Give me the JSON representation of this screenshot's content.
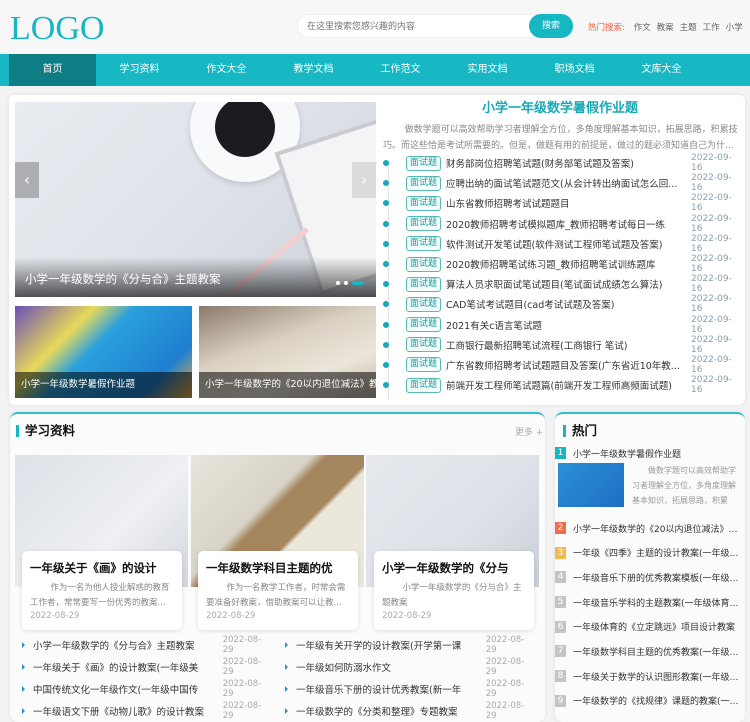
{
  "header": {
    "logo": "LOGO",
    "search_placeholder": "在这里搜索您感兴趣的内容",
    "search_button": "搜索",
    "hot_label": "热门搜索:",
    "hot_terms": [
      "作文",
      "教案",
      "主题",
      "工作",
      "小学"
    ]
  },
  "nav": {
    "items": [
      "首页",
      "学习资料",
      "作文大全",
      "教学文档",
      "工作范文",
      "实用文档",
      "职场文档",
      "文库大全"
    ],
    "active": 0
  },
  "slider": {
    "caption": "小学一年级数学的《分与合》主题教案",
    "prev": "‹",
    "next": "›",
    "slide_count": 3,
    "active_slide": 3
  },
  "thumbs": [
    {
      "caption": "小学一年级数学暑假作业题"
    },
    {
      "caption": "小学一年级数学的《20以内退位减法》教案"
    }
  ],
  "featured": {
    "title": "小学一年级数学暑假作业题",
    "desc": "做数学题可以高效帮助学习者理解全方位，多角度理解基本知识，拓展思路，积累技巧。而这些恰是考试所需要的。但是，做题有用的前提是，做过的题必须知道自己为什...",
    "tag": "面试题",
    "items": [
      {
        "title": "财务部岗位招聘笔试题(财务部笔试题及答案)",
        "date": "2022-09-16"
      },
      {
        "title": "应聘出纳的面试笔试题范文(从会计转出纳面试怎么回...",
        "date": "2022-09-16"
      },
      {
        "title": "山东省教师招聘考试试题题目",
        "date": "2022-09-16"
      },
      {
        "title": "2020教师招聘考试模拟题库_教师招聘考试每日一练",
        "date": "2022-09-16"
      },
      {
        "title": "软件测试开发笔试题(软件测试工程师笔试题及答案)",
        "date": "2022-09-16"
      },
      {
        "title": "2020教师招聘笔试练习题_教师招聘笔试训练题库",
        "date": "2022-09-16"
      },
      {
        "title": "算法人员求职面试笔试题目(笔试面试成绩怎么算法)",
        "date": "2022-09-16"
      },
      {
        "title": "CAD笔试考试题目(cad考试试题及答案)",
        "date": "2022-09-16"
      },
      {
        "title": "2021有关c语言笔试题",
        "date": "2022-09-16"
      },
      {
        "title": "工商银行最新招聘笔试流程(工商银行 笔试)",
        "date": "2022-09-16"
      },
      {
        "title": "广东省教师招聘考试试题题目及答案(广东省近10年教...",
        "date": "2022-09-16"
      },
      {
        "title": "前端开发工程师笔试题篇(前端开发工程师高频面试题)",
        "date": "2022-09-16"
      }
    ]
  },
  "study": {
    "title": "学习资料",
    "more": "更多 +",
    "cards": [
      {
        "title": "一年级关于《画》的设计",
        "desc": "作为一名为他人授业解惑的教育工作者，常常要写一份优秀的教案...",
        "date": "2022-08-29"
      },
      {
        "title": "一年级数学科目主题的优",
        "desc": "作为一名教学工作者，时常会需要准备好教案，借助教案可以让教...",
        "date": "2022-08-29"
      },
      {
        "title": "小学一年级数学的《分与",
        "desc": "小学一年级数学的《分与合》主题教案",
        "date": "2022-08-29"
      }
    ],
    "list_left": [
      {
        "title": "小学一年级数学的《分与合》主题教案",
        "date": "2022-08-29"
      },
      {
        "title": "一年级关于《画》的设计教案(一年级美",
        "date": "2022-08-29"
      },
      {
        "title": "中国传统文化一年级作文(一年级中国传",
        "date": "2022-08-29"
      },
      {
        "title": "一年级语文下册《动物儿歌》的设计教案",
        "date": "2022-08-29"
      }
    ],
    "list_right": [
      {
        "title": "一年级有关开学的设计教案(开学第一课",
        "date": "2022-08-29"
      },
      {
        "title": "一年级如何防溺水作文",
        "date": "2022-08-29"
      },
      {
        "title": "一年级音乐下册的设计优秀教案(新一年",
        "date": "2022-08-29"
      },
      {
        "title": "一年级数学的《分类和整理》专题教案",
        "date": "2022-08-29"
      }
    ]
  },
  "hot": {
    "title": "热门",
    "feature_desc": "做数学题可以高效帮助学习者理解全方位，多角度理解基本知识，拓展思路，积累技...",
    "items": [
      {
        "num": "1",
        "title": "小学一年级数学暑假作业题",
        "color": "#17b6c3"
      },
      {
        "num": "2",
        "title": "小学一年级数学的《20以内退位减法》教案",
        "color": "#f26b4a"
      },
      {
        "num": "3",
        "title": "一年级《四季》主题的设计教案(一年级四...",
        "color": "#f7b84a"
      },
      {
        "num": "4",
        "title": "一年级音乐下册的优秀教案模板(一年级下...",
        "color": "#c4c4c4"
      },
      {
        "num": "5",
        "title": "一年级音乐学科的主题教案(一年级体育学...",
        "color": "#c4c4c4"
      },
      {
        "num": "6",
        "title": "一年级体育的《立定跳远》项目设计教案",
        "color": "#c4c4c4"
      },
      {
        "num": "7",
        "title": "一年级数学科目主题的优秀教案(一年级数...",
        "color": "#c4c4c4"
      },
      {
        "num": "8",
        "title": "一年级关于数学的认识图形教案(一年级数...",
        "color": "#c4c4c4"
      },
      {
        "num": "9",
        "title": "一年级数学的《找规律》课题的教案(一年...",
        "color": "#c4c4c4"
      }
    ]
  }
}
